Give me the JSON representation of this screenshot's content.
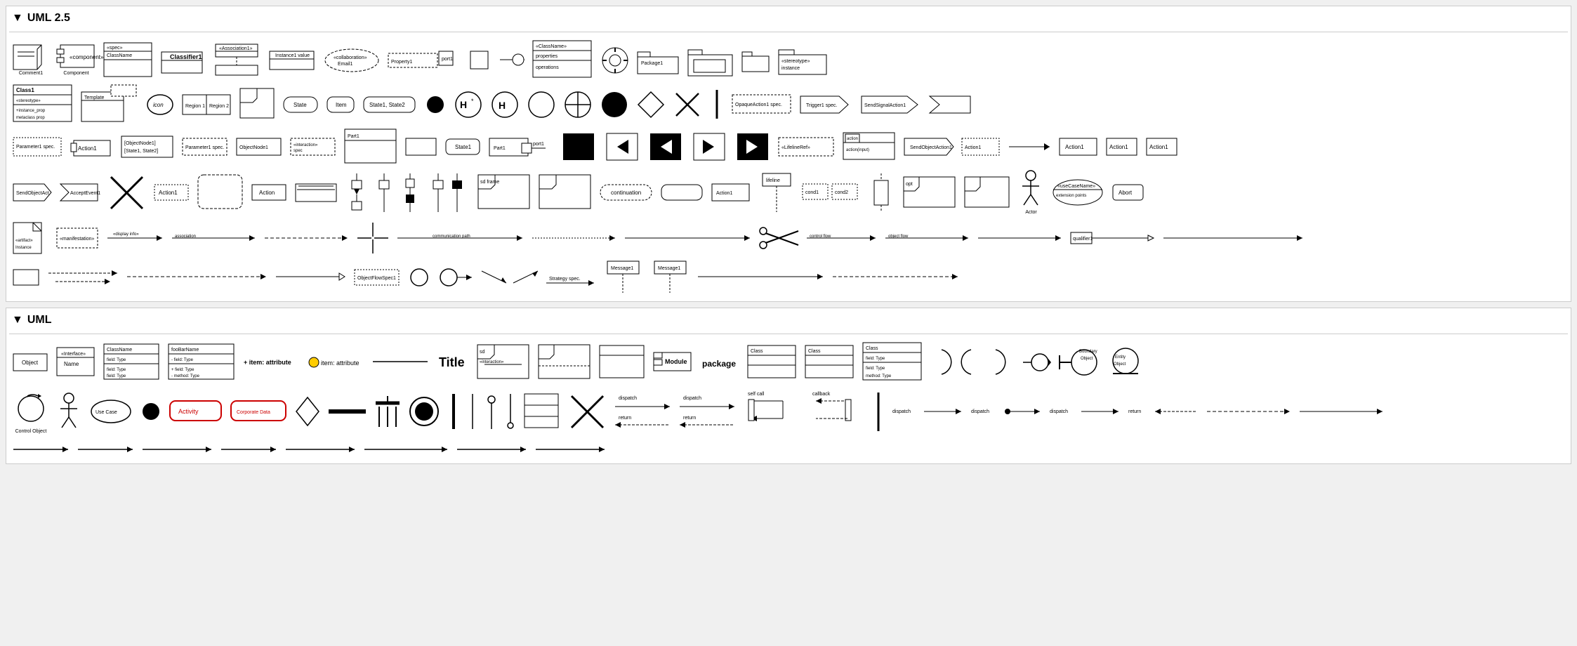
{
  "sections": [
    {
      "id": "uml25",
      "title": "UML 2.5",
      "expanded": true
    },
    {
      "id": "uml",
      "title": "UML",
      "expanded": true
    }
  ],
  "colors": {
    "black": "#000000",
    "white": "#ffffff",
    "red": "#cc0000",
    "gray_bg": "#f0f0f0",
    "border": "#cccccc"
  },
  "labels": {
    "self_call": "self call",
    "callback": "callback",
    "dispatch": "dispatch",
    "return": "return",
    "uml25": "UML 2.5",
    "uml": "UML"
  }
}
